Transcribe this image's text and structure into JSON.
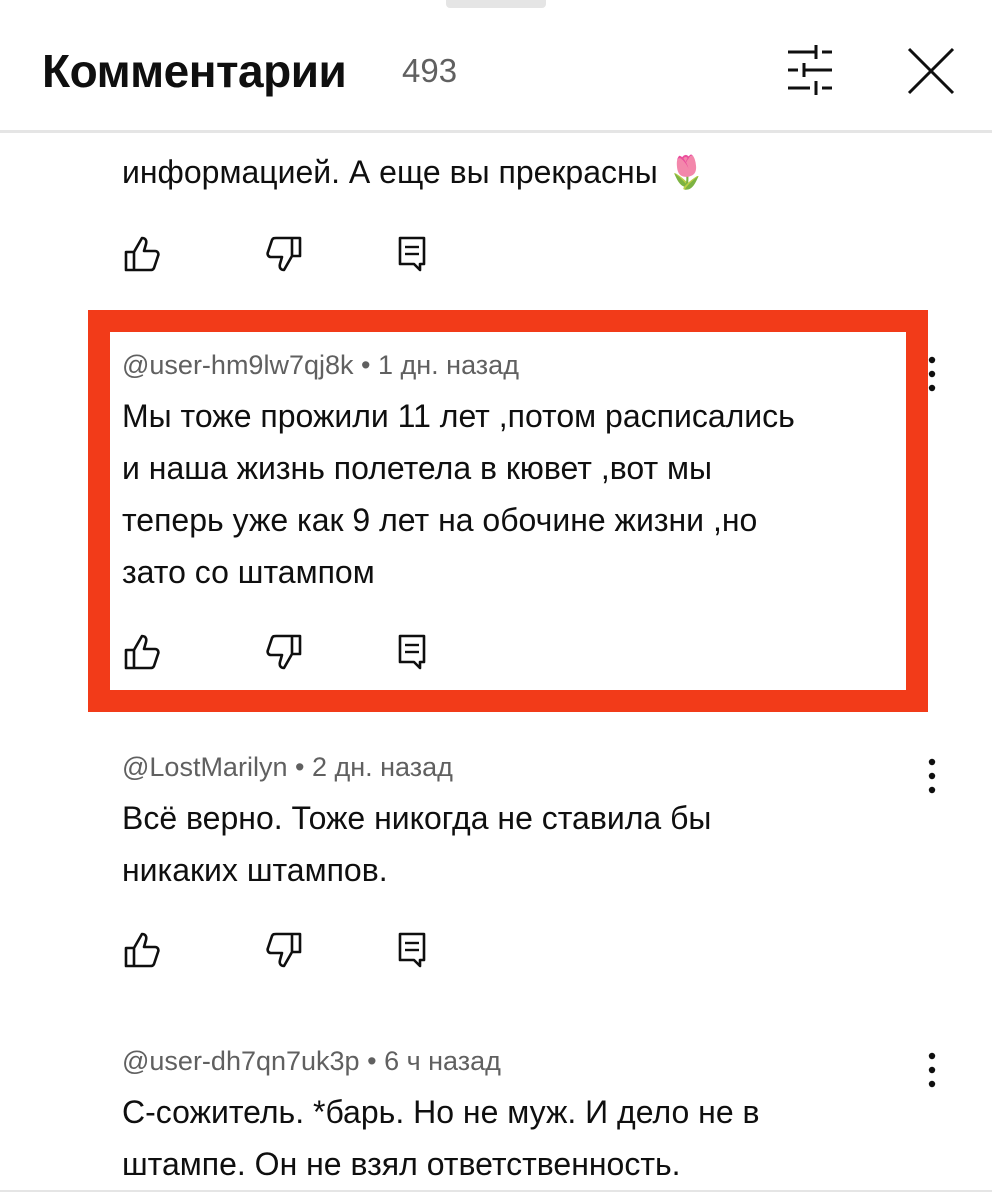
{
  "header": {
    "title": "Комментарии",
    "count": "493",
    "filter_icon": "sliders-icon",
    "close_icon": "close-icon"
  },
  "partial_comment": {
    "text_last_line": "информацией. А еще вы прекрасны 🌷"
  },
  "comments": [
    {
      "author": "@user-hm9lw7qj8k",
      "time": "1 дн. назад",
      "lines": [
        "Мы тоже прожили 11 лет ,потом расписались",
        "и наша жизнь полетела в кювет ,вот мы",
        "теперь уже как 9 лет на обочине жизни ,но",
        "зато со штампом"
      ]
    },
    {
      "author": "@LostMarilyn",
      "time": "2 дн. назад",
      "lines": [
        "Всё верно. Тоже никогда не ставила бы",
        "никаких штампов."
      ]
    },
    {
      "author": "@user-dh7qn7uk3p",
      "time": "6 ч назад",
      "lines": [
        "С-сожитель. *барь. Но не муж. И дело не в",
        "штампе. Он не взял ответственность."
      ]
    }
  ],
  "colors": {
    "highlight": "#f23b19",
    "secondary_text": "#606060",
    "divider": "#e5e5e5"
  }
}
